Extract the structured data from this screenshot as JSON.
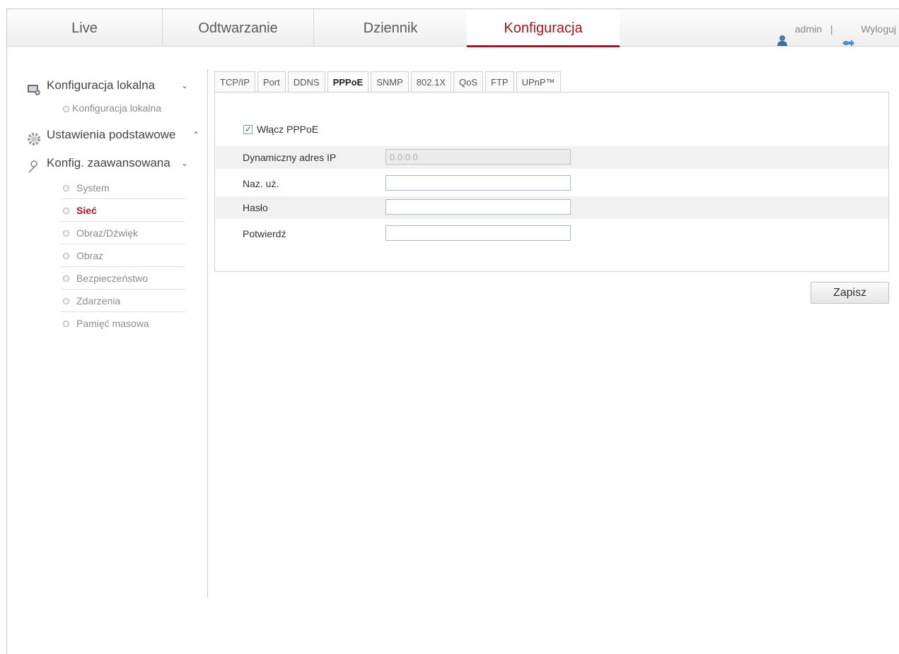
{
  "nav": {
    "tabs": [
      {
        "label": "Live"
      },
      {
        "label": "Odtwarzanie"
      },
      {
        "label": "Dziennik"
      },
      {
        "label": "Konfiguracja"
      }
    ],
    "active_index": 3,
    "user": "admin",
    "separator": "|",
    "logout": "Wyloguj"
  },
  "sidebar": {
    "sections": [
      {
        "label": "Konfiguracja lokalna",
        "icon": "monitor-config-icon",
        "chevron": "⌄",
        "items": [
          "Konfiguracja lokalna"
        ]
      },
      {
        "label": "Ustawienia podstawowe",
        "icon": "gear-icon",
        "chevron": "⌃",
        "items": []
      },
      {
        "label": "Konfig. zaawansowana",
        "icon": "wrench-icon",
        "chevron": "⌄",
        "items": [
          "System",
          "Sieć",
          "Obraz/Dźwięk",
          "Obraz",
          "Bezpieczeństwo",
          "Zdarzenia",
          "Pamięć masowa"
        ]
      }
    ],
    "active_item": "Sieć"
  },
  "subtabs": {
    "items": [
      "TCP/IP",
      "Port",
      "DDNS",
      "PPPoE",
      "SNMP",
      "802.1X",
      "QoS",
      "FTP",
      "UPnP™"
    ],
    "active": "PPPoE"
  },
  "form": {
    "enable_label": "Włącz PPPoE",
    "enable_checked": true,
    "fields": [
      {
        "label": "Dynamiczny adres IP",
        "value": "0.0.0.0",
        "disabled": true
      },
      {
        "label": "Naz. uż.",
        "value": "",
        "disabled": false
      },
      {
        "label": "Hasło",
        "value": "",
        "disabled": false
      },
      {
        "label": "Potwierdź",
        "value": "",
        "disabled": false
      }
    ],
    "save_label": "Zapisz"
  },
  "colors": {
    "accent": "#a8141c",
    "link_gray": "#8c8c8c"
  }
}
